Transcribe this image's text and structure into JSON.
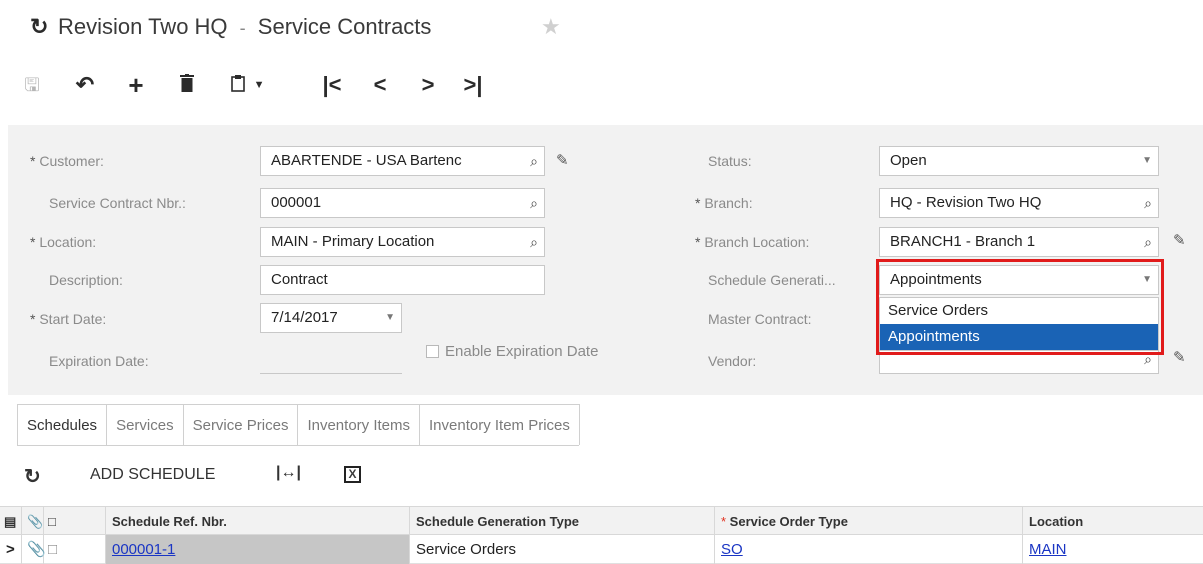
{
  "header": {
    "title": "Revision Two HQ",
    "separator": "-",
    "page": "Service Contracts",
    "refresh_icon": "refresh-icon",
    "favorite_icon": "star-icon"
  },
  "toolbar": {
    "save_icon": "save-icon",
    "undo_icon": "undo-icon",
    "add_icon": "plus-icon",
    "delete_icon": "trash-icon",
    "copy_paste_icon": "clipboard-icon",
    "first_icon": "first-record-icon",
    "prev_icon": "prev-record-icon",
    "next_icon": "next-record-icon",
    "last_icon": "last-record-icon"
  },
  "form": {
    "customer": {
      "label": "Customer:",
      "value": "ABARTENDE - USA Bartenc"
    },
    "contract_nbr": {
      "label": "Service Contract Nbr.:",
      "value": "000001"
    },
    "location": {
      "label": "Location:",
      "value": "MAIN - Primary Location"
    },
    "description": {
      "label": "Description:",
      "value": "Contract"
    },
    "start_date": {
      "label": "Start Date:",
      "value": "7/14/2017"
    },
    "expiration_date": {
      "label": "Expiration Date:",
      "value": ""
    },
    "enable_expiration": {
      "label": "Enable Expiration Date",
      "checked": false
    },
    "status": {
      "label": "Status:",
      "value": "Open"
    },
    "branch": {
      "label": "Branch:",
      "value": "HQ - Revision Two HQ"
    },
    "branch_location": {
      "label": "Branch Location:",
      "value": "BRANCH1 - Branch 1"
    },
    "schedule_gen": {
      "label": "Schedule Generati...",
      "value": "Appointments"
    },
    "master_contract": {
      "label": "Master Contract:",
      "value": ""
    },
    "vendor": {
      "label": "Vendor:",
      "value": ""
    }
  },
  "dropdown": {
    "options": [
      "Service Orders",
      "Appointments"
    ],
    "selected_index": 1,
    "highlight_color": "#1a63b5",
    "outline_color": "#e11b1b"
  },
  "tabs": [
    "Schedules",
    "Services",
    "Service Prices",
    "Inventory Items",
    "Inventory Item Prices"
  ],
  "grid_toolbar": {
    "refresh_icon": "refresh-icon",
    "add_schedule": "ADD SCHEDULE",
    "fit_icon": "fit-columns-icon",
    "export_icon": "excel-export-icon"
  },
  "grid": {
    "columns": [
      "Schedule Ref. Nbr.",
      "Schedule Generation Type",
      "Service Order Type",
      "Location"
    ],
    "rows": [
      {
        "ref": "000001-1",
        "gen_type": "Service Orders",
        "order_type": "SO",
        "location": "MAIN"
      }
    ]
  }
}
